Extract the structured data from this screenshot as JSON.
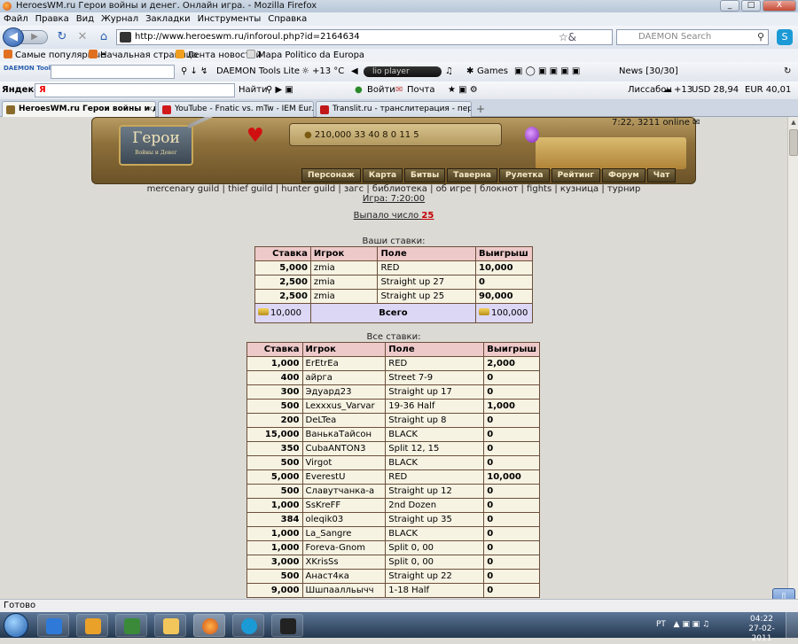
{
  "window": {
    "title": "HeroesWM.ru Герои войны и денег. Онлайн игра. - Mozilla Firefox",
    "controls": [
      "_",
      "□",
      "X"
    ]
  },
  "menu": [
    "Файл",
    "Правка",
    "Вид",
    "Журнал",
    "Закладки",
    "Инструменты",
    "Справка"
  ],
  "nav": {
    "url": "http://www.heroeswm.ru/inforoul.php?id=2164634",
    "search_placeholder": "DAEMON Search"
  },
  "bookmarks": [
    "Самые популярные",
    "Начальная страница",
    "Лента новостей",
    "Mapa Politico da Europa"
  ],
  "daemon": {
    "logo": "DAEMON Tools",
    "label": "DAEMON Tools Lite",
    "weather": "+13 °C",
    "player": "lio player",
    "games": "Games",
    "news": "News [30/30]"
  },
  "yandex": {
    "label": "Яндекс",
    "find": "Найти",
    "login": "Войти",
    "mail": "Почта",
    "city": "Лиссабон",
    "temp": "+13",
    "usd": "USD 28,94",
    "eur": "EUR 40,01"
  },
  "tabs": [
    {
      "label": "HeroesWM.ru Герои войны и де...",
      "active": true
    },
    {
      "label": "YouTube - Fnatic vs. mTw - IEM Eur...",
      "active": false
    },
    {
      "label": "Translit.ru - транслитерация - пер...",
      "active": false
    }
  ],
  "game": {
    "logo": "Герои",
    "logo_sub": "Войны и Денег",
    "resources": "210,000  33  40  8  0  11  5",
    "online": "7:22, 3211 online",
    "menu": [
      "Персонаж",
      "Карта",
      "Битвы",
      "Таверна",
      "Рулетка",
      "Рейтинг",
      "Форум",
      "Чат"
    ],
    "links": [
      "mercenary guild",
      "thief guild",
      "hunter guild",
      "загс",
      "библиотека",
      "об игре",
      "блокнот",
      "fights",
      "кузница",
      "турнир"
    ],
    "game_time": "Игра: 7:20:00",
    "result_label": "Выпало число",
    "result_value": "25"
  },
  "your_bets": {
    "caption": "Ваши ставки:",
    "headers": [
      "Ставка",
      "Игрок",
      "Поле",
      "Выигрыш"
    ],
    "rows": [
      [
        "5,000",
        "zmia",
        "RED",
        "10,000"
      ],
      [
        "2,500",
        "zmia",
        "Straight up 27",
        "0"
      ],
      [
        "2,500",
        "zmia",
        "Straight up 25",
        "90,000"
      ]
    ],
    "total": {
      "stake": "10,000",
      "label": "Всего",
      "win": "100,000"
    }
  },
  "all_bets": {
    "caption": "Все ставки:",
    "headers": [
      "Ставка",
      "Игрок",
      "Поле",
      "Выигрыш"
    ],
    "rows": [
      [
        "1,000",
        "ErEtrEa",
        "RED",
        "2,000"
      ],
      [
        "400",
        "айрга",
        "Street 7-9",
        "0"
      ],
      [
        "300",
        "Эдуард23",
        "Straight up 17",
        "0"
      ],
      [
        "500",
        "Lexxxus_Varvar",
        "19-36 Half",
        "1,000"
      ],
      [
        "200",
        "DeLTea",
        "Straight up 8",
        "0"
      ],
      [
        "15,000",
        "ВанькаТайсон",
        "BLACK",
        "0"
      ],
      [
        "350",
        "CubaANTON3",
        "Split 12, 15",
        "0"
      ],
      [
        "500",
        "Virgot",
        "BLACK",
        "0"
      ],
      [
        "5,000",
        "EverestU",
        "RED",
        "10,000"
      ],
      [
        "500",
        "Славутчанка-а",
        "Straight up 12",
        "0"
      ],
      [
        "1,000",
        "SsKreFF",
        "2nd Dozen",
        "0"
      ],
      [
        "384",
        "oleqik03",
        "Straight up 35",
        "0"
      ],
      [
        "1,000",
        "La_Sangre",
        "BLACK",
        "0"
      ],
      [
        "1,000",
        "Foreva-Gnom",
        "Split 0, 00",
        "0"
      ],
      [
        "3,000",
        "XKrisSs",
        "Split 0, 00",
        "0"
      ],
      [
        "500",
        "Анаст4ка",
        "Straight up 22",
        "0"
      ],
      [
        "9,000",
        "Шшпаалльычч",
        "1-18 Half",
        "0"
      ]
    ]
  },
  "status": "Готово",
  "taskbar": {
    "lang": "PT",
    "time": "04:22",
    "date": "27-02-2011"
  }
}
